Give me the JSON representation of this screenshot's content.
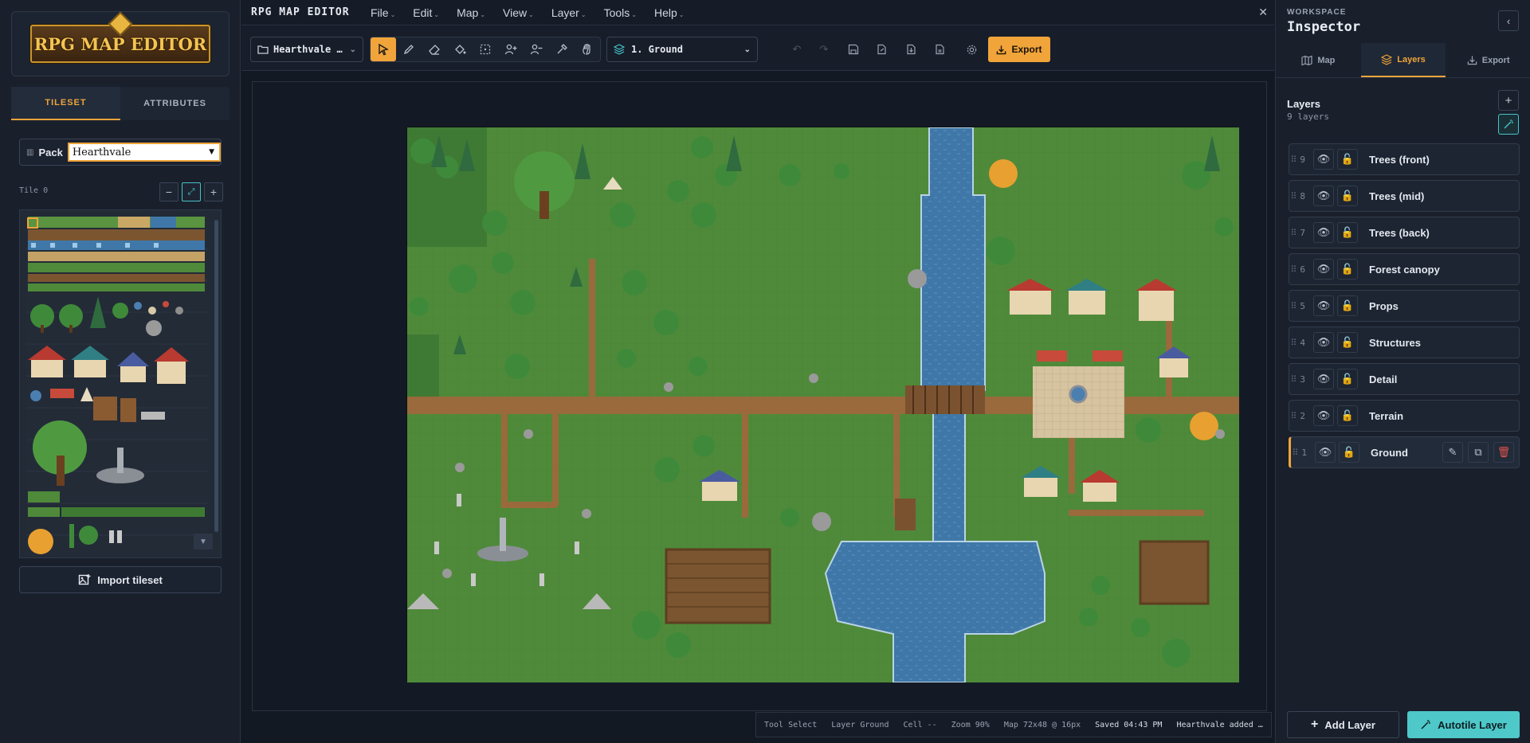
{
  "app": {
    "title": "RPG MAP EDITOR",
    "logo_text": "RPG MAP EDITOR"
  },
  "menu": [
    {
      "label": "File"
    },
    {
      "label": "Edit"
    },
    {
      "label": "Map"
    },
    {
      "label": "View"
    },
    {
      "label": "Layer"
    },
    {
      "label": "Tools"
    },
    {
      "label": "Help"
    }
  ],
  "left_panel": {
    "tabs": [
      {
        "label": "TILESET",
        "active": true
      },
      {
        "label": "ATTRIBUTES",
        "active": false
      }
    ],
    "pack_label": "Pack",
    "pack_value": "Hearthvale",
    "tile_label": "Tile 0",
    "import_label": "Import tileset"
  },
  "toolbar": {
    "project": "Hearthvale …",
    "layer_select": "1. Ground",
    "export_label": "Export",
    "tools": [
      "select-tool",
      "pencil-tool",
      "eraser-tool",
      "fill-tool",
      "rect-select-tool",
      "add-npc-tool",
      "remove-npc-tool",
      "eyedropper-tool",
      "pan-tool"
    ]
  },
  "status": {
    "tool": "Tool Select",
    "layer": "Layer Ground",
    "cell": "Cell --",
    "zoom": "Zoom 90%",
    "map": "Map 72x48 @ 16px",
    "saved": "Saved 04:43 PM",
    "message": "Hearthvale added …"
  },
  "inspector": {
    "workspace_label": "WORKSPACE",
    "title": "Inspector",
    "tabs": [
      {
        "label": "Map",
        "active": false
      },
      {
        "label": "Layers",
        "active": true
      },
      {
        "label": "Export",
        "active": false
      }
    ],
    "layers_title": "Layers",
    "layers_count": "9 layers",
    "layers": [
      {
        "num": "9",
        "name": "Trees (front)",
        "active": false
      },
      {
        "num": "8",
        "name": "Trees (mid)",
        "active": false
      },
      {
        "num": "7",
        "name": "Trees (back)",
        "active": false
      },
      {
        "num": "6",
        "name": "Forest canopy",
        "active": false
      },
      {
        "num": "5",
        "name": "Props",
        "active": false
      },
      {
        "num": "4",
        "name": "Structures",
        "active": false
      },
      {
        "num": "3",
        "name": "Detail",
        "active": false
      },
      {
        "num": "2",
        "name": "Terrain",
        "active": false
      },
      {
        "num": "1",
        "name": "Ground",
        "active": true
      }
    ],
    "add_layer_label": "Add Layer",
    "autotile_label": "Autotile Layer"
  },
  "colors": {
    "accent": "#f0a43a",
    "teal": "#4ec8c8",
    "grass": "#4f8a3a",
    "water": "#3f78a8",
    "path": "#9a6a3c",
    "danger": "#e2544c"
  }
}
